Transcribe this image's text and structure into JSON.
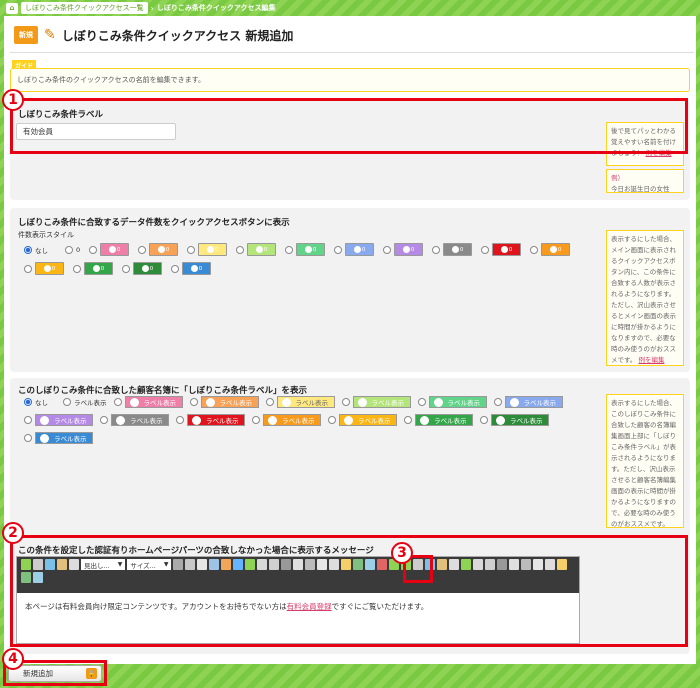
{
  "breadcrumb": {
    "home_icon": "home-icon",
    "link": "しぼりこみ条件クイックアクセス一覧",
    "current": "しぼりこみ条件クイックアクセス編集"
  },
  "header": {
    "badge": "新規",
    "title": "しぼりこみ条件クイックアクセス 新規追加"
  },
  "guide": {
    "tag": "ガイド",
    "text": "しぼりこみ条件のクイックアクセスの名前を編集できます。"
  },
  "label_section": {
    "title": "しぼりこみ条件ラベル",
    "value": "有効会員",
    "note_text": "後で見てパッとわかる覚えやすい名前を付けましょう！",
    "note_link": "例を編集",
    "example_title": "例）",
    "example_text": "今日お誕生日の女性"
  },
  "count_section": {
    "title": "しぼりこみ条件に合致するデータ件数をクイックアクセスボタンに表示",
    "subtitle": "件数表示スタイル",
    "opt_none": "なし",
    "opt_plain": "0",
    "chip_text": "0",
    "chip_colors": [
      "#f07fa7",
      "#f7a257",
      "#ffe97f",
      "#b4e57a",
      "#62d48a",
      "#89a9ef",
      "#b58ae6",
      "#8a8a8a",
      "#e0141c",
      "#f79a1d",
      "#fbb515",
      "#33a64a",
      "#2d8b3a",
      "#3a8bd6"
    ],
    "note": "表示するにした場合、メイン画面に表示されるクイックアクセスボタン内に、この条件に合致する人数が表示されるようになります。ただし、沢山表示させるとメイン画面の表示に時間が掛かるようになりますので、必要な時のみ使うのがおススメです。",
    "note_link": "例を編集"
  },
  "name_section": {
    "title": "このしぼりこみ条件に合致した顧客名簿に「しぼりこみ条件ラベル」を表示",
    "opt_none": "なし",
    "opt_plain": "ラベル表示",
    "chip_text": "ラベル表示",
    "chip_colors": [
      "#f07fa7",
      "#f7a257",
      "#ffe97f",
      "#b4e57a",
      "#62d48a",
      "#89a9ef",
      "#b58ae6",
      "#8a8a8a",
      "#e0141c",
      "#f79a1d",
      "#fbb515",
      "#33a64a",
      "#2d8b3a",
      "#3a8bd6"
    ],
    "note": "表示するにした場合、このしぼりこみ条件に合致した顧客の名簿編集画面上部に「しぼりこみ条件ラベル」が表示されるようになります。ただし、沢山表示させると顧客名簿編集画面の表示に時間が掛かるようになりますので、必要な時のみ使うのがおススメです。"
  },
  "editor_section": {
    "title": "この条件を設定した認証有りホームページパーツの合致しなかった場合に表示するメッセージ",
    "toolbar": {
      "heading_select": "見出し...",
      "size_select": "サイズ..."
    },
    "body_text": "本ページは有料会員向け限定コンテンツです。アカウントをお持ちでない方は",
    "body_link": "有料会員登録",
    "body_text2": "ですぐにご覧いただけます。"
  },
  "footer": {
    "submit": "新規追加"
  },
  "callouts": [
    "1",
    "2",
    "3",
    "4"
  ]
}
